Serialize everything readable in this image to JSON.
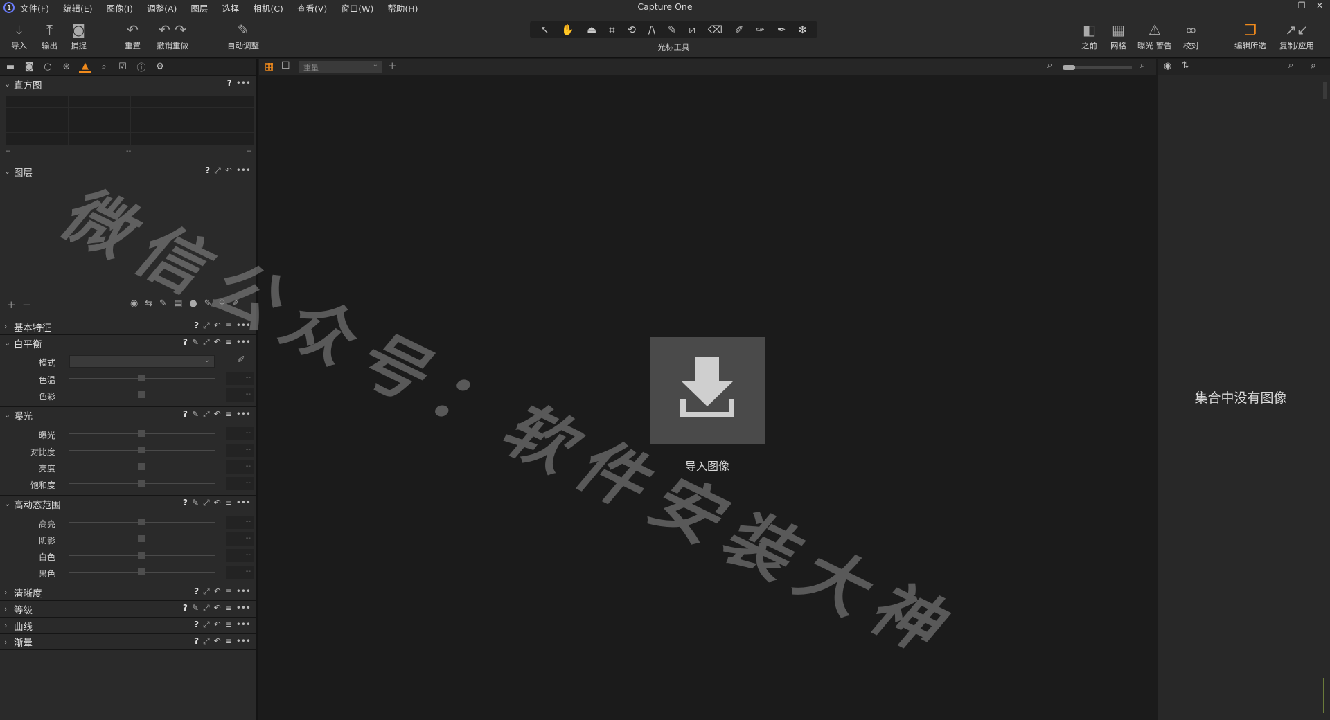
{
  "app": {
    "title": "Capture One"
  },
  "menu": [
    "文件(F)",
    "编辑(E)",
    "图像(I)",
    "调整(A)",
    "图层",
    "选择",
    "相机(C)",
    "查看(V)",
    "窗口(W)",
    "帮助(H)"
  ],
  "toolbar": {
    "import": "导入",
    "export": "输出",
    "capture": "捕捉",
    "reset": "重置",
    "undo_redo": "撤销重做",
    "auto_adjust": "自动调整",
    "cursor_tools": "光标工具",
    "before": "之前",
    "grid": "网格",
    "exposure_warning": "曝光 警告",
    "proof": "校对",
    "edit_selected": "编辑所选",
    "copy_apply": "复制/应用"
  },
  "left": {
    "histogram": {
      "title": "直方图",
      "min": "--",
      "mid": "--",
      "max": "--"
    },
    "layers": {
      "title": "图层"
    },
    "basic": {
      "title": "基本特征"
    },
    "white_balance": {
      "title": "白平衡",
      "mode_label": "模式",
      "temp_label": "色温",
      "tint_label": "色彩",
      "temp_value": "--",
      "tint_value": "--"
    },
    "exposure": {
      "title": "曝光",
      "rows": [
        {
          "label": "曝光",
          "value": "--"
        },
        {
          "label": "对比度",
          "value": "--"
        },
        {
          "label": "亮度",
          "value": "--"
        },
        {
          "label": "饱和度",
          "value": "--"
        }
      ]
    },
    "hdr": {
      "title": "高动态范围",
      "rows": [
        {
          "label": "高亮",
          "value": "--"
        },
        {
          "label": "阴影",
          "value": "--"
        },
        {
          "label": "白色",
          "value": "--"
        },
        {
          "label": "黑色",
          "value": "--"
        }
      ]
    },
    "clarity": {
      "title": "清晰度"
    },
    "levels": {
      "title": "等级"
    },
    "curve": {
      "title": "曲线"
    },
    "vignette": {
      "title": "渐晕"
    }
  },
  "center": {
    "sort_label": "重量",
    "import_label": "导入图像"
  },
  "right": {
    "empty_message": "集合中没有图像"
  },
  "watermark": "微信公众号：软件安装大神",
  "colors": {
    "accent": "#f08a1c",
    "panel": "#2a2a2a",
    "background": "#1b1b1b"
  }
}
